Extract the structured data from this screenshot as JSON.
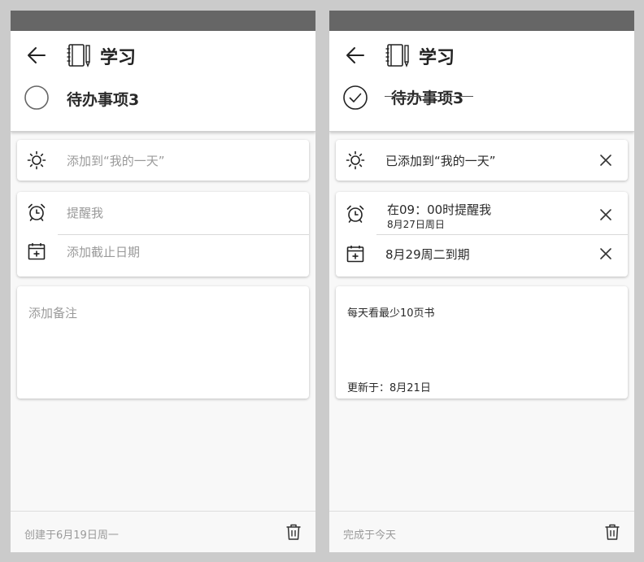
{
  "left": {
    "list_name": "学习",
    "task_title": "待办事项3",
    "my_day_label": "添加到“我的一天”",
    "reminder_label": "提醒我",
    "due_label": "添加截止日期",
    "note_placeholder": "添加备注",
    "footer_text": "创建于6月19日周一"
  },
  "right": {
    "list_name": "学习",
    "task_title": "待办事项3",
    "my_day_label": "已添加到“我的一天”",
    "reminder_label": "在09：00时提醒我",
    "reminder_sub": "8月27日周日",
    "due_label": "8月29周二到期",
    "note_text": "每天看最少10页书",
    "note_updated": "更新于：8月21日",
    "footer_text": "完成于今天"
  },
  "icons": {
    "back": "back-arrow-icon",
    "list": "notebook-icon",
    "my_day": "sun-icon",
    "reminder": "alarm-clock-icon",
    "due": "calendar-add-icon",
    "remove": "close-icon",
    "delete": "trash-icon"
  },
  "colors": {
    "status_bar": "#666666",
    "background": "#cbcbcb",
    "panel": "#f8f8f8",
    "text": "#2a2a2a",
    "muted": "#9a9a9a"
  }
}
